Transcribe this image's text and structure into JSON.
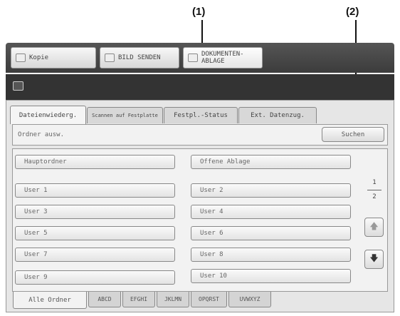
{
  "callouts": [
    "(1)",
    "(2)"
  ],
  "modes": [
    {
      "label": "Kopie",
      "icon": "copy-icon"
    },
    {
      "label": "BILD SENDEN",
      "icon": "send-icon"
    },
    {
      "label": "DOKUMENTEN-\nABLAGE",
      "icon": "document-filing-icon"
    }
  ],
  "tabs": [
    "Dateienwiederg.",
    "Scannen auf Festplatte",
    "Festpl.-Status",
    "Ext. Datenzug."
  ],
  "bar": {
    "label": "Ordner ausw.",
    "search_label": "Suchen"
  },
  "folders": {
    "main": "Hauptordner",
    "quick": "Offene Ablage",
    "users": [
      "User 1",
      "User 2",
      "User 3",
      "User 4",
      "User 5",
      "User 6",
      "User 7",
      "User 8",
      "User 9",
      "User 10"
    ]
  },
  "pagination": {
    "current": "1",
    "total": "2"
  },
  "bottom_tabs": [
    "Alle Ordner",
    "ABCD",
    "EFGHI",
    "JKLMN",
    "OPQRST",
    "UVWXYZ"
  ]
}
